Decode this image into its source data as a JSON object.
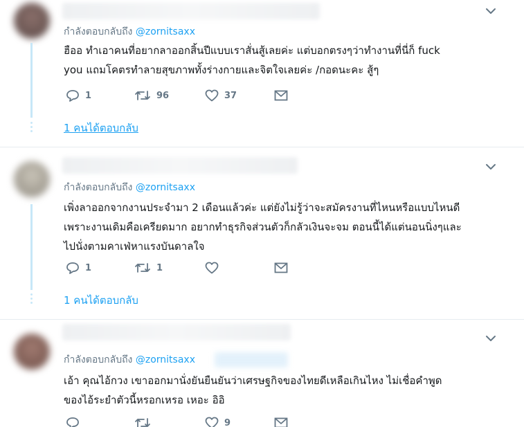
{
  "tweets": [
    {
      "reply_prefix": "กำลังตอบกลับถึง",
      "reply_handle": "@zornitsaxx",
      "text_lines": [
        "ฮืออ ทำเอาคนที่อยากลาออกสิ้นปีแบบเราสั่นสู้เลยค่ะ แต่บอกตรงๆว่าทำงานที่นี่ก็ fuck",
        "you แถมโคตรทำลายสุขภาพทั้งร่างกายและจิตใจเลยค่ะ /กอดนะคะ สู้ๆ"
      ],
      "replies": "1",
      "retweets": "96",
      "likes": "37",
      "thread_link": "1 คนได้ตอบกลับ"
    },
    {
      "reply_prefix": "กำลังตอบกลับถึง",
      "reply_handle": "@zornitsaxx",
      "text_lines": [
        "เพิ่งลาออกจากงานประจำมา 2 เดือนแล้วค่ะ แต่ยังไม่รู้ว่าจะสมัครงานที่ไหนหรือแบบไหนดี",
        "เพราะงานเดิมคือเครียดมาก อยากทำธุรกิจส่วนตัวก็กลัวเงินจะจม ตอนนี้ได้แต่นอนนิ่งๆและ",
        "ไปนั่งตามคาเฟ่หาแรงบันดาลใจ"
      ],
      "replies": "1",
      "retweets": "1",
      "likes": "",
      "thread_link": "1 คนได้ตอบกลับ"
    },
    {
      "reply_prefix": "กำลังตอบกลับถึง",
      "reply_handle": "@zornitsaxx",
      "text_lines": [
        "เอ้า คุณไอ้กวง  เขาออกมานั่งยันยืนยันว่าเศรษฐกิจของไทยดีเหลือเกินไหง  ไม่เชื่อคำพูด",
        "ของไอ้ระยำตัวนี้หรอกเหรอ  เหอะ  อิอิ"
      ],
      "replies": "",
      "retweets": "",
      "likes": "9"
    }
  ],
  "icons": {
    "reply": "reply-icon",
    "retweet": "retweet-icon",
    "like": "heart-icon",
    "dm": "envelope-icon",
    "more": "chevron-down-icon"
  },
  "colors": {
    "link": "#1da1f2",
    "muted": "#657786",
    "thread_line": "#c7e7f8",
    "divider": "#e6ecf0"
  }
}
